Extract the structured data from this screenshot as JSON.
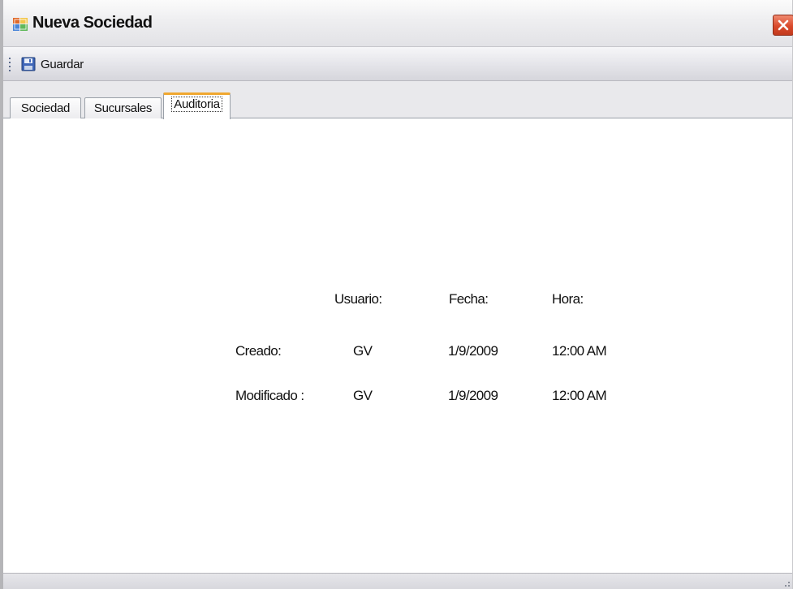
{
  "window": {
    "title": "Nueva Sociedad",
    "close_glyph": "X"
  },
  "toolbar": {
    "save_label": "Guardar",
    "save_icon": "floppy-disk-icon"
  },
  "tabs": [
    {
      "label": "Sociedad",
      "active": false
    },
    {
      "label": "Sucursales",
      "active": false
    },
    {
      "label": "Auditoria",
      "active": true
    }
  ],
  "audit": {
    "headers": {
      "usuario": "Usuario:",
      "fecha": "Fecha:",
      "hora": "Hora:"
    },
    "rows": [
      {
        "label": "Creado:",
        "usuario": "GV",
        "fecha": "1/9/2009",
        "hora": "12:00 AM"
      },
      {
        "label": "Modificado :",
        "usuario": "GV",
        "fecha": "1/9/2009",
        "hora": "12:00 AM"
      }
    ]
  },
  "colors": {
    "active_tab_accent": "#f0a830",
    "close_button": "#d94a2c"
  }
}
